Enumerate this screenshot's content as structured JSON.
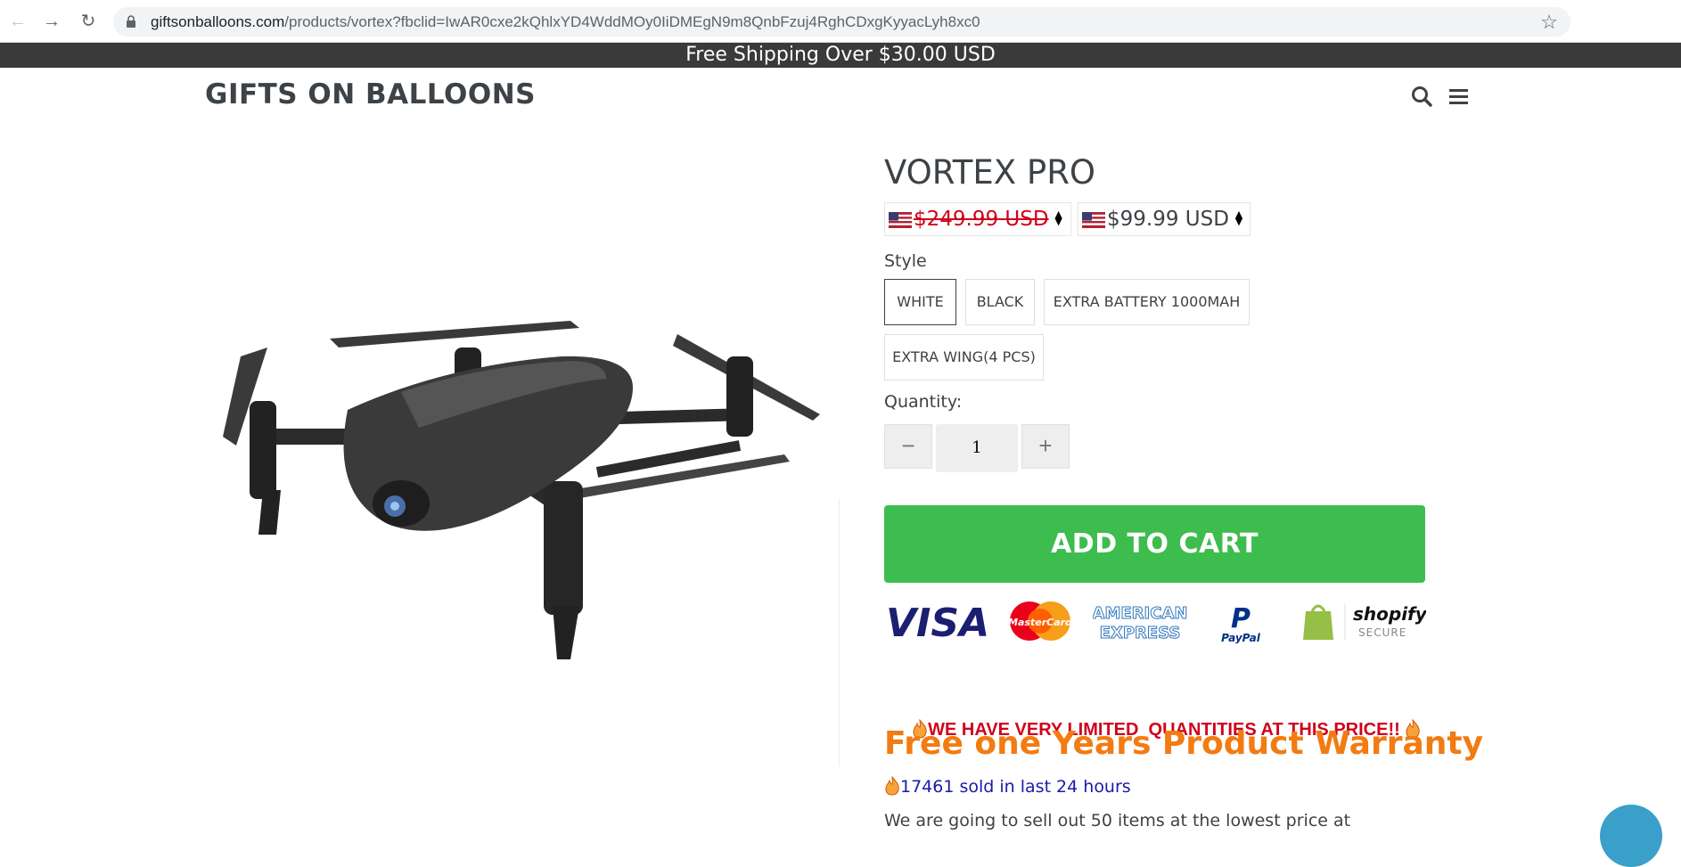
{
  "browser": {
    "url_host": "giftsonballoons.com",
    "url_path": "/products/vortex?fbclid=IwAR0cxe2kQhlxYD4WddMOy0IiDMEgN9m8QnbFzuj4RghCDxgKyyacLyh8xc0"
  },
  "promo_bar": {
    "text": "Free Shipping Over $30.00 USD"
  },
  "header": {
    "logo": "GIFTS ON BALLOONS"
  },
  "product": {
    "title": "VORTEX PRO",
    "compare_price": "$249.99 USD",
    "price": "$99.99 USD",
    "style_label": "Style",
    "styles": [
      "WHITE",
      "BLACK",
      "EXTRA BATTERY 1000MAH",
      "EXTRA WING(4 PCS)"
    ],
    "selected_style": "WHITE",
    "quantity_label": "Quantity:",
    "quantity": "1",
    "add_to_cart": "ADD TO CART"
  },
  "payment": {
    "visa": "VISA",
    "mastercard": "MasterCard",
    "amex_1": "AMERICAN",
    "amex_2": "EXPRESS",
    "paypal": "PayPal",
    "shopify": "shopify",
    "shopify_secure": "SECURE"
  },
  "promo": {
    "limited": "WE HAVE VERY LIMITED  QUANTITIES AT THIS PRICE!!",
    "warranty": "Free one Years Product Warranty",
    "sold": "17461 sold in last 24 hours",
    "cutoff": "We are going to sell out 50 items at the lowest price at"
  },
  "colors": {
    "accent_green": "#3dbd4e",
    "warranty_orange": "#f27b12",
    "sale_red": "#d0021b"
  }
}
